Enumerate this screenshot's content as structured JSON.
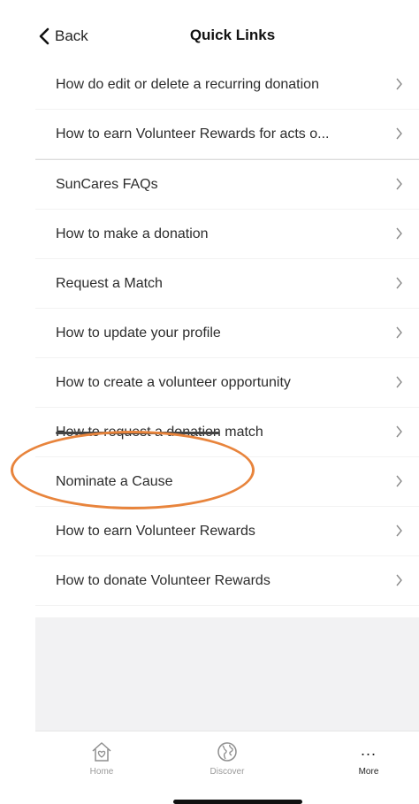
{
  "header": {
    "back_label": "Back",
    "title": "Quick Links"
  },
  "links": [
    {
      "label": "How do edit or delete a recurring donation"
    },
    {
      "label": "How to earn Volunteer Rewards for acts o..."
    },
    {
      "label": "SunCares FAQs"
    },
    {
      "label": "How to make a donation"
    },
    {
      "label": "Request a Match"
    },
    {
      "label": "How to update your profile"
    },
    {
      "label": "How to create a volunteer opportunity"
    },
    {
      "label": "How to request a donation match"
    },
    {
      "label": "Nominate a Cause"
    },
    {
      "label": "How to earn Volunteer Rewards"
    },
    {
      "label": "How to donate Volunteer Rewards"
    }
  ],
  "annotation": {
    "highlighted_item": "Nominate a Cause",
    "highlight_color": "#e8843c"
  },
  "tabbar": {
    "home_label": "Home",
    "discover_label": "Discover",
    "more_label": "More",
    "more_glyph": "...",
    "active": "More"
  },
  "icons": {
    "back": "chevron-left-icon",
    "row": "chevron-right-icon",
    "home": "home-heart-icon",
    "discover": "globe-icon",
    "more": "more-dots-icon"
  }
}
